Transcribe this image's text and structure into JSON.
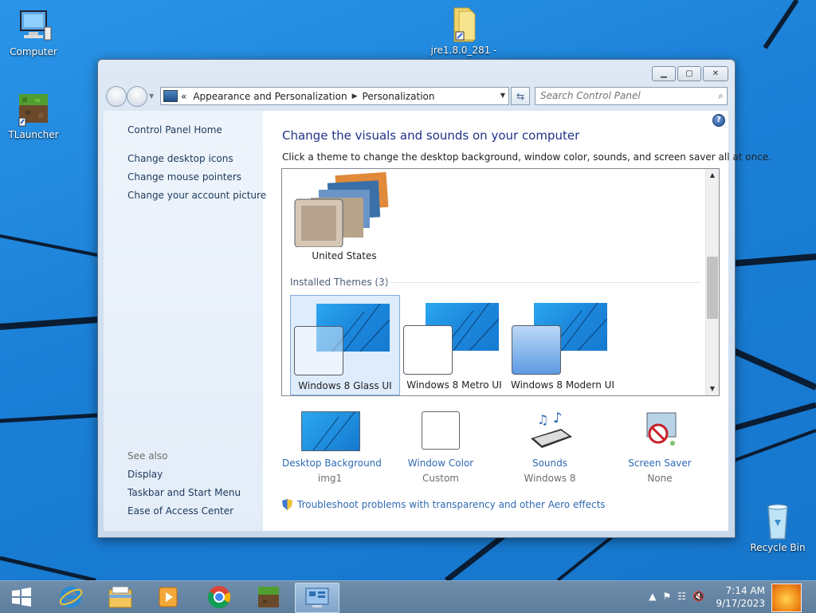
{
  "desktop": {
    "icons": [
      {
        "label": "Computer"
      },
      {
        "label": "jre1.8.0_281 -"
      },
      {
        "label": "TLauncher"
      },
      {
        "label": "Recycle Bin"
      }
    ]
  },
  "window": {
    "address": {
      "overflow": "«",
      "crumb1": "Appearance and Personalization",
      "crumb2": "Personalization"
    },
    "search_placeholder": "Search Control Panel",
    "sidebar": {
      "home": "Control Panel Home",
      "links": [
        "Change desktop icons",
        "Change mouse pointers",
        "Change your account picture"
      ],
      "see_also_label": "See also",
      "see_also": [
        "Display",
        "Taskbar and Start Menu",
        "Ease of Access Center"
      ]
    },
    "main": {
      "title": "Change the visuals and sounds on your computer",
      "subtitle": "Click a theme to change the desktop background, window color, sounds, and screen saver all at once.",
      "online_theme": "United States",
      "installed_header": "Installed Themes (3)",
      "themes": [
        "Windows 8 Glass UI",
        "Windows 8 Metro UI",
        "Windows 8 Modern UI"
      ],
      "selected_theme": "Windows 8 Glass UI",
      "bottom": [
        {
          "label": "Desktop Background",
          "value": "img1"
        },
        {
          "label": "Window Color",
          "value": "Custom"
        },
        {
          "label": "Sounds",
          "value": "Windows 8"
        },
        {
          "label": "Screen Saver",
          "value": "None"
        }
      ],
      "troubleshoot": "Troubleshoot problems with transparency and other Aero effects"
    }
  },
  "taskbar": {
    "time": "7:14 AM",
    "date": "9/17/2023"
  }
}
